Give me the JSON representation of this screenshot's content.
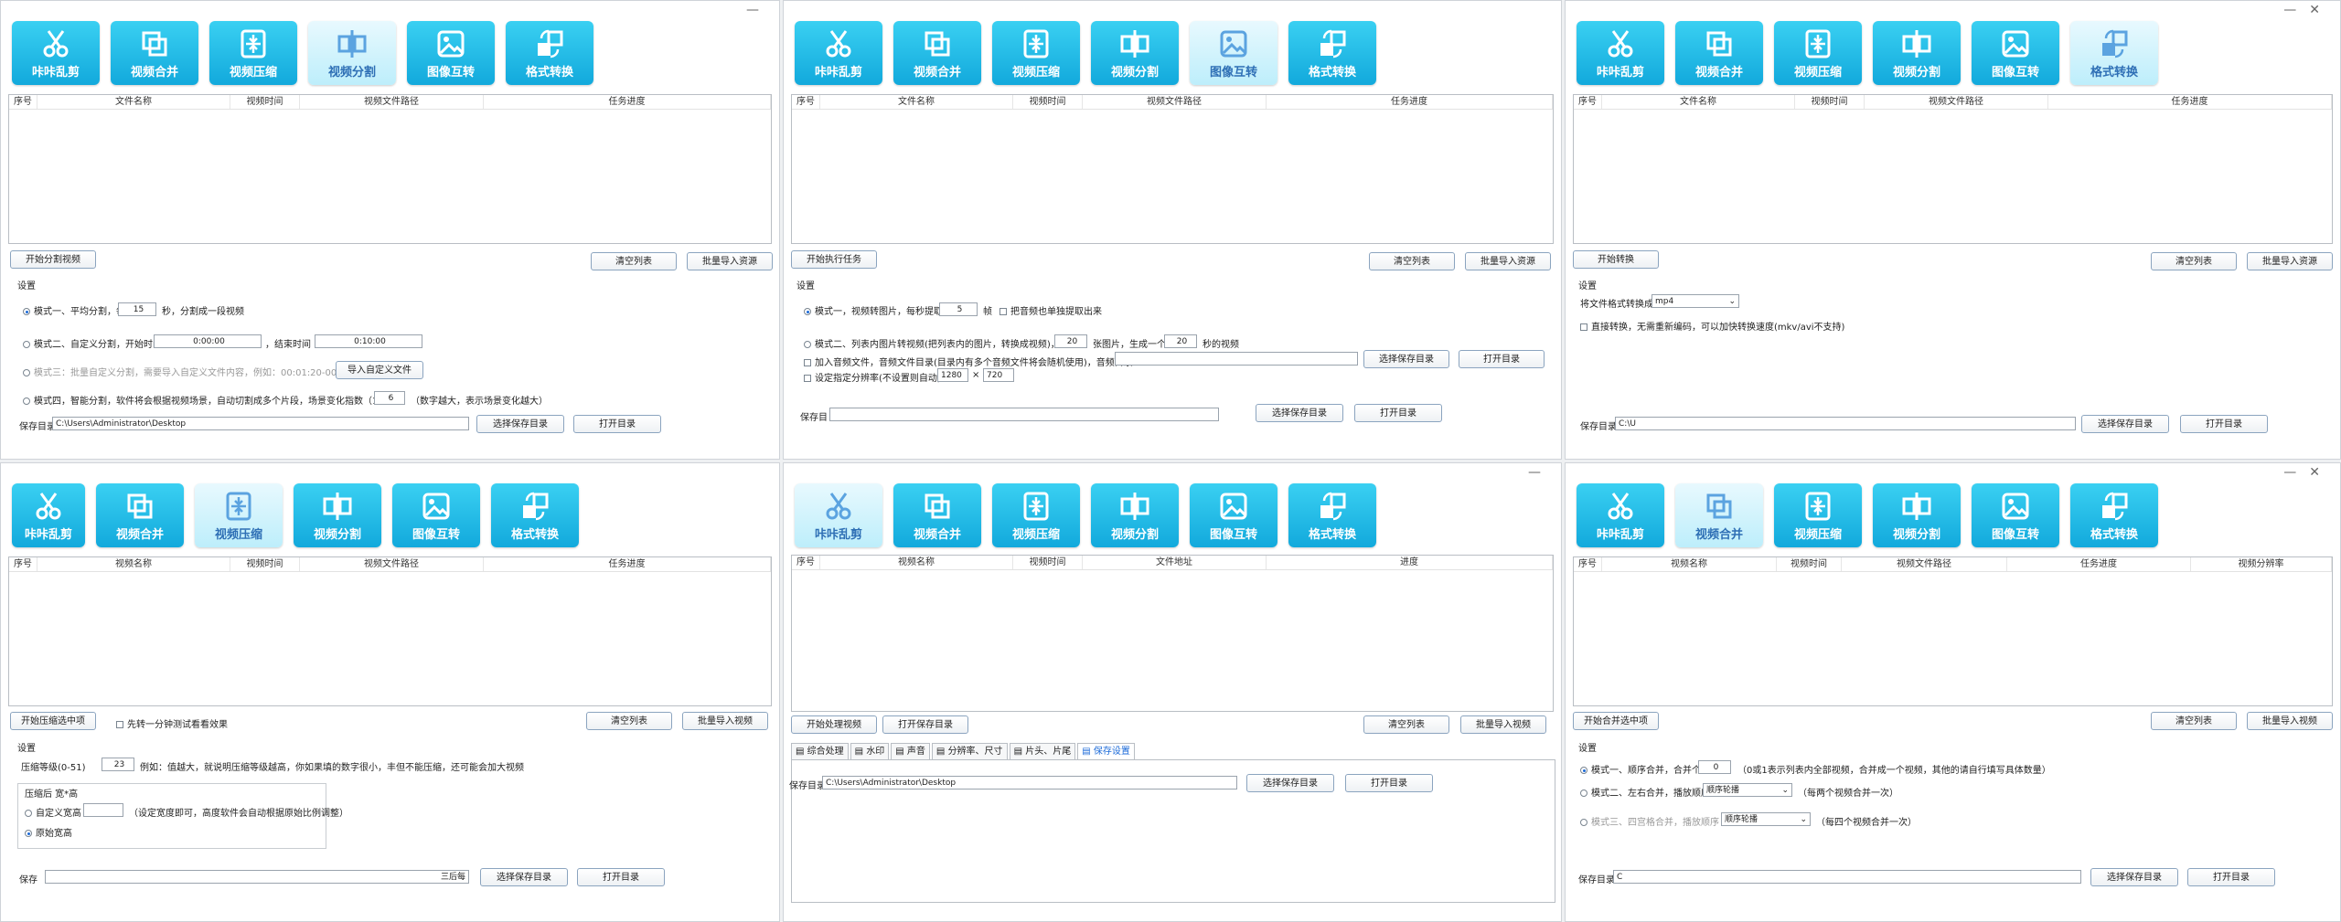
{
  "window_controls": {
    "min": "—",
    "close": "✕"
  },
  "toolbar": {
    "cut": "咔咔乱剪",
    "merge": "视频合并",
    "compress": "视频压缩",
    "split": "视频分割",
    "image": "图像互转",
    "format": "格式转换"
  },
  "common": {
    "clear_list": "清空列表",
    "batch_import_res": "批量导入资源",
    "batch_import_video": "批量导入视频",
    "settings": "设置",
    "save_dir_label": "保存目录",
    "choose_save_dir": "选择保存目录",
    "open_dir": "打开目录",
    "desktop_path": "C:\\Users\\Administrator\\Desktop"
  },
  "p1": {
    "cols": [
      "序号",
      "文件名称",
      "视频时间",
      "视频文件路径",
      "任务进度"
    ],
    "start": "开始分割视频",
    "m1_pre": "模式一、平均分割，每",
    "m1_val": "15",
    "m1_post": "秒，分割成一段视频",
    "m2_pre": "模式二、自定义分割，开始时间",
    "m2_start": "0:00:00",
    "m2_mid": "，结束时间",
    "m2_end": "0:10:00",
    "m3": "模式三：批量自定义分割，需要导入自定义文件内容，例如：00:01:20-00:03:40",
    "m3_btn": "导入自定义文件",
    "m4_pre": "模式四，智能分割，软件将会根据视频场景，自动切割成多个片段，场景变化指数（1-10）",
    "m4_val": "6",
    "m4_post": "（数字越大，表示场景变化越大）",
    "save_label": "保存目录"
  },
  "p2": {
    "cols": [
      "序号",
      "文件名称",
      "视频时间",
      "视频文件路径",
      "任务进度"
    ],
    "start": "开始执行任务",
    "m1_pre": "模式一，视频转图片，每秒提取",
    "m1_val": "5",
    "m1_post": "帧",
    "m1_chk": "把音频也单独提取出来",
    "m2_pre": "模式二、列表内图片转视频(把列表内的图片，转换成视频)，每",
    "m2_val1": "20",
    "m2_mid": "张图片，生成一个",
    "m2_val2": "20",
    "m2_post": "秒的视频",
    "audio": "加入音频文件，音频文件目录(目录内有多个音频文件将会随机使用)，音频目录",
    "res": "设定指定分辨率(不设置则自动)",
    "res_w": "1280",
    "res_x": "×",
    "res_h": "720",
    "save_label": "保存目"
  },
  "p3": {
    "cols": [
      "序号",
      "文件名称",
      "视频时间",
      "视频文件路径",
      "任务进度"
    ],
    "start": "开始转换",
    "fmt_label": "将文件格式转换成",
    "fmt_val": "mp4",
    "direct": "直接转换，无需重新编码，可以加快转换速度(mkv/avi不支持)",
    "save_label": "保存目录",
    "save_val": "C:\\U"
  },
  "p4": {
    "cols": [
      "序号",
      "视频名称",
      "视频时间",
      "视频文件路径",
      "任务进度"
    ],
    "start": "开始压缩选中项",
    "preview": "先转一分钟测试看看效果",
    "crf_label": "压缩等级(0-51)",
    "crf_val": "23",
    "crf_hint": "例如：值越大，就说明压缩等级越高，你如果填的数字很小，丰但不能压缩，还可能会加大视频",
    "group": "压缩后 宽*高",
    "custom": "自定义宽高",
    "custom_hint": "（设定宽度即可，高度软件会自动根据原始比例调整）",
    "original": "原始宽高",
    "save_label": "保存",
    "save_tail": "三后每"
  },
  "p5": {
    "cols": [
      "序号",
      "视频名称",
      "视频时间",
      "文件地址",
      "进度"
    ],
    "start": "开始处理视频",
    "open_save": "打开保存目录",
    "tabs": [
      "综合处理",
      "水印",
      "声音",
      "分辨率、尺寸",
      "片头、片尾",
      "保存设置"
    ],
    "save_label": "保存目录"
  },
  "p6": {
    "cols": [
      "序号",
      "视频名称",
      "视频时间",
      "视频文件路径",
      "任务进度",
      "视频分辨率"
    ],
    "start": "开始合并选中项",
    "m1_pre": "模式一、顺序合并，合并个数",
    "m1_val": "0",
    "m1_post": "（0或1表示列表内全部视频，合并成一个视频，其他的请自行填写具体数量）",
    "m2": "模式二、左右合并，播放顺序",
    "m2_sel": "顺序轮播",
    "m2_hint": "（每两个视频合并一次）",
    "m3": "模式三、四宫格合并，播放顺序",
    "m3_sel": "顺序轮播",
    "m3_hint": "（每四个视频合并一次）",
    "save_label": "保存目录",
    "save_val": "C"
  }
}
